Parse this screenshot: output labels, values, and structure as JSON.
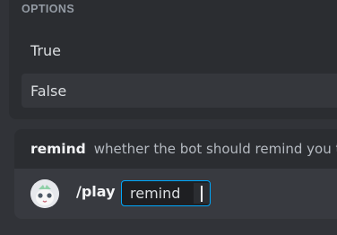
{
  "options_popup": {
    "header": "OPTIONS",
    "options": [
      {
        "label": "True"
      },
      {
        "label": "False"
      }
    ]
  },
  "hint": {
    "name": "remind",
    "description": "whether the bot should remind you t"
  },
  "composer": {
    "command": "/play",
    "param_label": "remind"
  },
  "colors": {
    "highlight_row": "#35373c",
    "focus_border": "#00a8fc"
  }
}
